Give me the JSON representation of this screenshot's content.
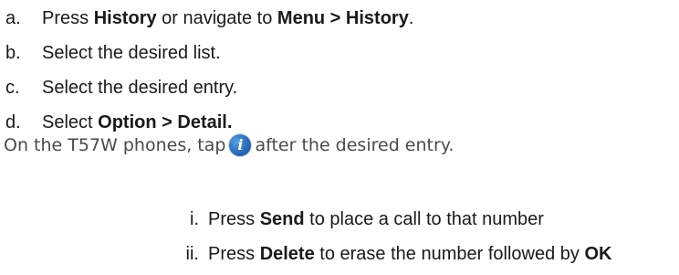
{
  "steps": [
    {
      "marker": "a.",
      "text_1": "Press ",
      "bold_1": "History",
      "text_2": " or navigate to ",
      "bold_2": "Menu > History",
      "text_3": "."
    },
    {
      "marker": "b.",
      "text_1": "Select the desired list."
    },
    {
      "marker": "c.",
      "text_1": "Select the desired entry."
    },
    {
      "marker": "d.",
      "text_1": "Select ",
      "bold_1": "Option > Detail."
    }
  ],
  "note": {
    "before": "On the T57W phones, tap",
    "icon": "info-icon",
    "icon_glyph": "i",
    "after": "after the desired entry."
  },
  "substeps": [
    {
      "marker": "i.",
      "text_1": "Press ",
      "bold_1": "Send",
      "text_2": " to place a call to that number"
    },
    {
      "marker": "ii.",
      "text_1": "Press ",
      "bold_1": "Delete",
      "text_2": " to erase the number followed by ",
      "bold_2": "OK"
    }
  ]
}
